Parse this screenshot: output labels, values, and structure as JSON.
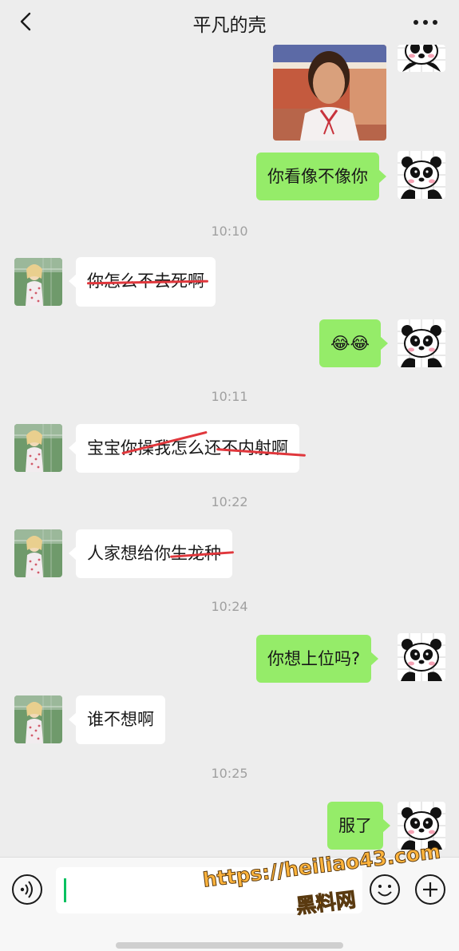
{
  "header": {
    "title": "平凡的壳",
    "back_icon": "chevron-left-icon",
    "more_icon": "more-dots-icon"
  },
  "messages": [
    {
      "kind": "image",
      "sender": "me",
      "description": "image-message"
    },
    {
      "kind": "text",
      "sender": "me",
      "text": "你看像不像你"
    },
    {
      "kind": "time",
      "text": "10:10"
    },
    {
      "kind": "text",
      "sender": "other",
      "text": "你怎么不去死啊",
      "strikethrough": true
    },
    {
      "kind": "text",
      "sender": "me",
      "text": "😂😂"
    },
    {
      "kind": "time",
      "text": "10:11"
    },
    {
      "kind": "text",
      "sender": "other",
      "text": "宝宝你操我怎么还不内射啊",
      "strikethrough": true
    },
    {
      "kind": "time",
      "text": "10:22"
    },
    {
      "kind": "text",
      "sender": "other",
      "text": "人家想给你生龙种",
      "strikethrough": true
    },
    {
      "kind": "time",
      "text": "10:24"
    },
    {
      "kind": "text",
      "sender": "me",
      "text": "你想上位吗?"
    },
    {
      "kind": "text",
      "sender": "other",
      "text": "谁不想啊"
    },
    {
      "kind": "time",
      "text": "10:25"
    },
    {
      "kind": "text",
      "sender": "me",
      "text": "服了"
    }
  ],
  "input_bar": {
    "voice_icon": "voice-icon",
    "emoji_icon": "emoji-icon",
    "plus_icon": "plus-icon",
    "value": ""
  },
  "watermark": {
    "url": "https://heiliao43.com",
    "text": "黑料网"
  },
  "colors": {
    "my_bubble": "#95ec69",
    "their_bubble": "#ffffff",
    "background": "#ededed",
    "strike": "#e0373c",
    "watermark": "#ffb43c"
  }
}
